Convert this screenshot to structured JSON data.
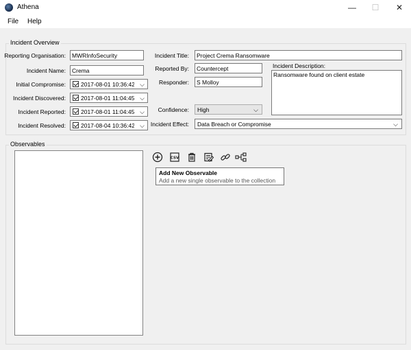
{
  "window": {
    "title": "Athena",
    "minimize": "—",
    "maximize": "☐",
    "close": "✕"
  },
  "menu": {
    "file": "File",
    "help": "Help"
  },
  "overview": {
    "group_label": "Incident Overview",
    "reporting_org_label": "Reporting Organisation:",
    "reporting_org_value": "MWRInfoSecurity",
    "incident_name_label": "Incident Name:",
    "incident_name_value": "Crema",
    "initial_compromise_label": "Initial Compromise:",
    "initial_compromise_value": "2017-08-01 10:36:42",
    "incident_discovered_label": "Incident Discovered:",
    "incident_discovered_value": "2017-08-01 11:04:45",
    "incident_reported_label": "Incident Reported:",
    "incident_reported_value": "2017-08-01 11:04:45",
    "incident_resolved_label": "Incident Resolved:",
    "incident_resolved_value": "2017-08-04 10:36:42",
    "incident_title_label": "Incident Title:",
    "incident_title_value": "Project Crema Ransomware",
    "reported_by_label": "Reported By:",
    "reported_by_value": "Countercept",
    "responder_label": "Responder:",
    "responder_value": "S Molloy",
    "confidence_label": "Confidence:",
    "confidence_value": "High",
    "incident_effect_label": "Incident Effect:",
    "incident_effect_value": "Data Breach or Compromise",
    "description_label": "Incident Description:",
    "description_value": "Ransomware found on client estate"
  },
  "observables": {
    "group_label": "Observables",
    "toolbar": {
      "add_icon": "plus-circle-icon",
      "csv_icon": "csv-icon",
      "delete_icon": "trash-icon",
      "edit_icon": "edit-list-icon",
      "link_icon": "link-icon",
      "share_icon": "relationship-icon"
    },
    "tooltip": {
      "title": "Add New Observable",
      "body": "Add a new single observable to the collection"
    }
  }
}
